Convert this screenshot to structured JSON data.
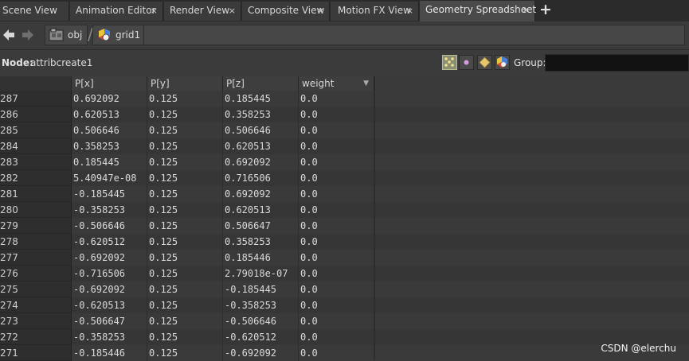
{
  "tabs": [
    {
      "label": "Scene View",
      "active": false
    },
    {
      "label": "Animation Editor",
      "active": false
    },
    {
      "label": "Render View",
      "active": false
    },
    {
      "label": "Composite View",
      "active": false
    },
    {
      "label": "Motion FX View",
      "active": false
    },
    {
      "label": "Geometry Spreadsheet",
      "active": true
    }
  ],
  "close_glyph": "×",
  "add_tab_glyph": "+",
  "path": {
    "back_icon": "back-arrow-icon",
    "forward_icon": "forward-arrow-icon",
    "crumbs": [
      {
        "label": "obj",
        "icon": "obj-network-icon"
      },
      {
        "label": "grid1",
        "icon": "geometry-node-icon"
      }
    ]
  },
  "node": {
    "label": "Node:",
    "value": "attribcreate1"
  },
  "filters": [
    {
      "icon": "points-icon",
      "active": true
    },
    {
      "icon": "vertices-icon",
      "active": false
    },
    {
      "icon": "primitives-icon",
      "active": false
    },
    {
      "icon": "detail-icon",
      "active": false
    }
  ],
  "group": {
    "label": "Group:",
    "value": ""
  },
  "columns": [
    "P[x]",
    "P[y]",
    "P[z]",
    "weight"
  ],
  "sort_glyph": "▼",
  "rows": [
    {
      "index": "287",
      "px": "0.692092",
      "py": "0.125",
      "pz": "0.185445",
      "weight": "0.0"
    },
    {
      "index": "286",
      "px": "0.620513",
      "py": "0.125",
      "pz": "0.358253",
      "weight": "0.0"
    },
    {
      "index": "285",
      "px": "0.506646",
      "py": "0.125",
      "pz": "0.506646",
      "weight": "0.0"
    },
    {
      "index": "284",
      "px": "0.358253",
      "py": "0.125",
      "pz": "0.620513",
      "weight": "0.0"
    },
    {
      "index": "283",
      "px": "0.185445",
      "py": "0.125",
      "pz": "0.692092",
      "weight": "0.0"
    },
    {
      "index": "282",
      "px": "5.40947e-08",
      "py": "0.125",
      "pz": "0.716506",
      "weight": "0.0"
    },
    {
      "index": "281",
      "px": "-0.185445",
      "py": "0.125",
      "pz": "0.692092",
      "weight": "0.0"
    },
    {
      "index": "280",
      "px": "-0.358253",
      "py": "0.125",
      "pz": "0.620513",
      "weight": "0.0"
    },
    {
      "index": "279",
      "px": "-0.506646",
      "py": "0.125",
      "pz": "0.506647",
      "weight": "0.0"
    },
    {
      "index": "278",
      "px": "-0.620512",
      "py": "0.125",
      "pz": "0.358253",
      "weight": "0.0"
    },
    {
      "index": "277",
      "px": "-0.692092",
      "py": "0.125",
      "pz": "0.185446",
      "weight": "0.0"
    },
    {
      "index": "276",
      "px": "-0.716506",
      "py": "0.125",
      "pz": "2.79018e-07",
      "weight": "0.0"
    },
    {
      "index": "275",
      "px": "-0.692092",
      "py": "0.125",
      "pz": "-0.185445",
      "weight": "0.0"
    },
    {
      "index": "274",
      "px": "-0.620513",
      "py": "0.125",
      "pz": "-0.358253",
      "weight": "0.0"
    },
    {
      "index": "273",
      "px": "-0.506647",
      "py": "0.125",
      "pz": "-0.506646",
      "weight": "0.0"
    },
    {
      "index": "272",
      "px": "-0.358253",
      "py": "0.125",
      "pz": "-0.620512",
      "weight": "0.0"
    },
    {
      "index": "271",
      "px": "-0.185446",
      "py": "0.125",
      "pz": "-0.692092",
      "weight": "0.0"
    }
  ],
  "watermark": "CSDN @elerchu",
  "colors": {
    "active_filter": "#8a8f73",
    "background": "#3a3a3a",
    "group_field": "#121212"
  }
}
